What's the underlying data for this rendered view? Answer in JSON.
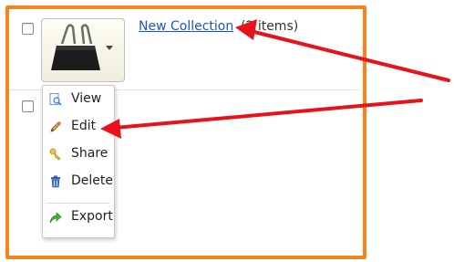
{
  "collection": {
    "link_text": "New Collection",
    "item_count": "(2 items)"
  },
  "menu": {
    "items": [
      {
        "label": "View",
        "icon": "view-icon"
      },
      {
        "label": "Edit",
        "icon": "pencil-icon"
      },
      {
        "label": "Share",
        "icon": "share-icon"
      },
      {
        "label": "Delete",
        "icon": "trash-icon"
      },
      {
        "label": "Export",
        "icon": "export-icon"
      }
    ]
  },
  "colors": {
    "frame": "#f5861f",
    "link": "#1a55cc",
    "annotation_arrow": "#e8121b"
  }
}
